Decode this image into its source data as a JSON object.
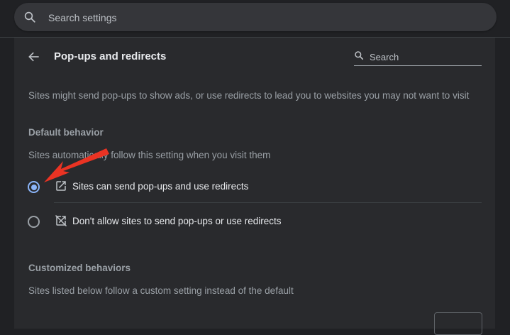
{
  "top": {
    "search_placeholder": "Search settings",
    "search_icon": "search-icon"
  },
  "header": {
    "title": "Pop-ups and redirects",
    "back_icon": "arrow-back-icon",
    "search_placeholder": "Search"
  },
  "description": "Sites might send pop-ups to show ads, or use redirects to lead you to websites you may not want to visit",
  "default_behavior": {
    "heading": "Default behavior",
    "subtext": "Sites automatically follow this setting when you visit them",
    "options": [
      {
        "label": "Sites can send pop-ups and use redirects",
        "icon": "open-in-new-icon",
        "selected": true
      },
      {
        "label": "Don't allow sites to send pop-ups or use redirects",
        "icon": "blocked-open-in-new-icon",
        "selected": false
      }
    ]
  },
  "customized_behaviors": {
    "heading": "Customized behaviors",
    "subtext": "Sites listed below follow a custom setting instead of the default"
  },
  "colors": {
    "background": "#202124",
    "card": "#292a2d",
    "accent": "#8ab4f8",
    "annotation_arrow": "#ea3323"
  }
}
